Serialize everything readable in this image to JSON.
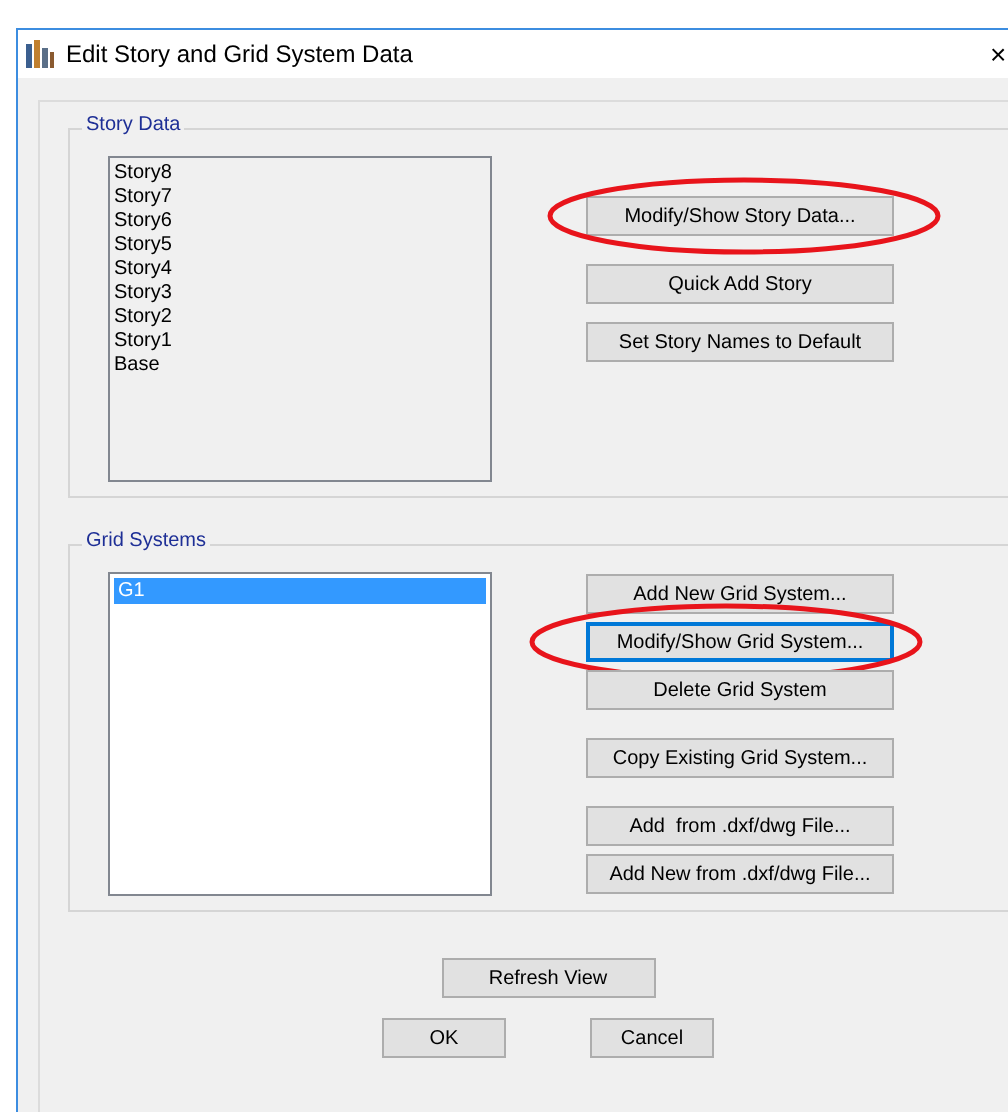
{
  "window": {
    "title": "Edit Story and Grid System Data",
    "close": "×"
  },
  "story_data": {
    "title": "Story Data",
    "stories": [
      "Story8",
      "Story7",
      "Story6",
      "Story5",
      "Story4",
      "Story3",
      "Story2",
      "Story1",
      "Base"
    ],
    "button_groups": [
      [
        {
          "label": "Modify/Show Story Data...",
          "circled": true
        }
      ],
      [
        {
          "label": "Quick Add Story",
          "circled": false
        },
        {
          "label": "Set Story Names to Default",
          "circled": false
        }
      ]
    ]
  },
  "grid_systems": {
    "title": "Grid Systems",
    "items": [
      {
        "label": "G1",
        "selected": true
      }
    ],
    "button_groups": [
      [
        {
          "label": "Add New Grid System...",
          "circled": false,
          "focused": false
        },
        {
          "label": "Modify/Show Grid System...",
          "circled": true,
          "focused": true
        },
        {
          "label": "Delete Grid System",
          "circled": false,
          "focused": false
        }
      ],
      [
        {
          "label": "Copy Existing Grid System...",
          "circled": false,
          "focused": false
        }
      ],
      [
        {
          "label": "Add  from .dxf/dwg File...",
          "circled": false,
          "focused": false
        },
        {
          "label": "Add New from .dxf/dwg File...",
          "circled": false,
          "focused": false
        }
      ]
    ]
  },
  "footer": {
    "refresh": "Refresh View",
    "ok": "OK",
    "cancel": "Cancel"
  }
}
